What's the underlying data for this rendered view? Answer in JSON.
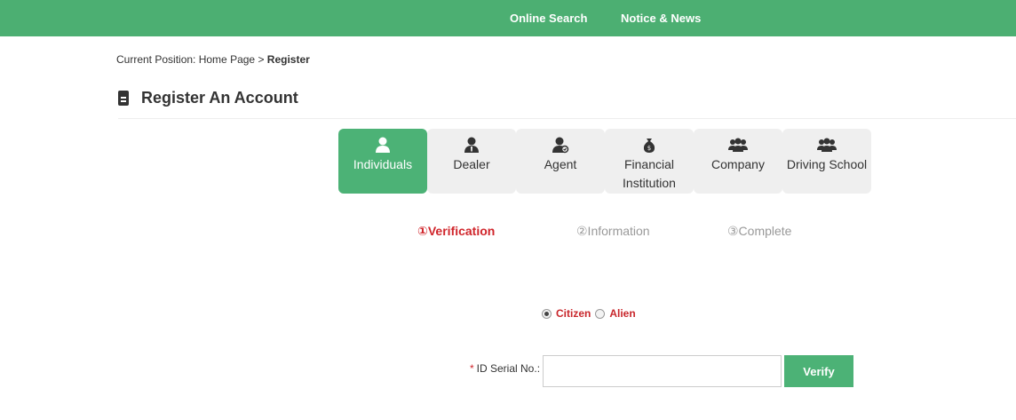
{
  "topnav": {
    "online_search": "Online Search",
    "notice_news": "Notice & News"
  },
  "breadcrumb": {
    "prefix": "Current Position:",
    "home": "Home Page",
    "separator": ">",
    "current": "Register"
  },
  "page": {
    "title": "Register An Account",
    "title_icon": "document-icon"
  },
  "tabs": [
    {
      "label": "Individuals",
      "icon": "user-icon",
      "active": true
    },
    {
      "label": "Dealer",
      "icon": "dealer-icon",
      "active": false
    },
    {
      "label": "Agent",
      "icon": "agent-icon",
      "active": false
    },
    {
      "label_line1": "Financial",
      "label_line2": "Institution",
      "icon": "money-bag-icon",
      "active": false
    },
    {
      "label": "Company",
      "icon": "group-icon",
      "active": false
    },
    {
      "label": "Driving School",
      "icon": "group-icon",
      "active": false
    }
  ],
  "steps": [
    {
      "label": "①Verification",
      "active": true
    },
    {
      "label": "②Information",
      "active": false
    },
    {
      "label": "③Complete",
      "active": false
    }
  ],
  "residency": {
    "options": [
      "Citizen",
      "Alien"
    ],
    "selected": "Citizen"
  },
  "form": {
    "required_mark": "*",
    "id_label": "ID Serial No.:",
    "id_value": "",
    "verify_label": "Verify"
  },
  "colors": {
    "brand_green": "#4caf72",
    "active_red": "#d0252b",
    "inactive_grey": "#999999"
  }
}
